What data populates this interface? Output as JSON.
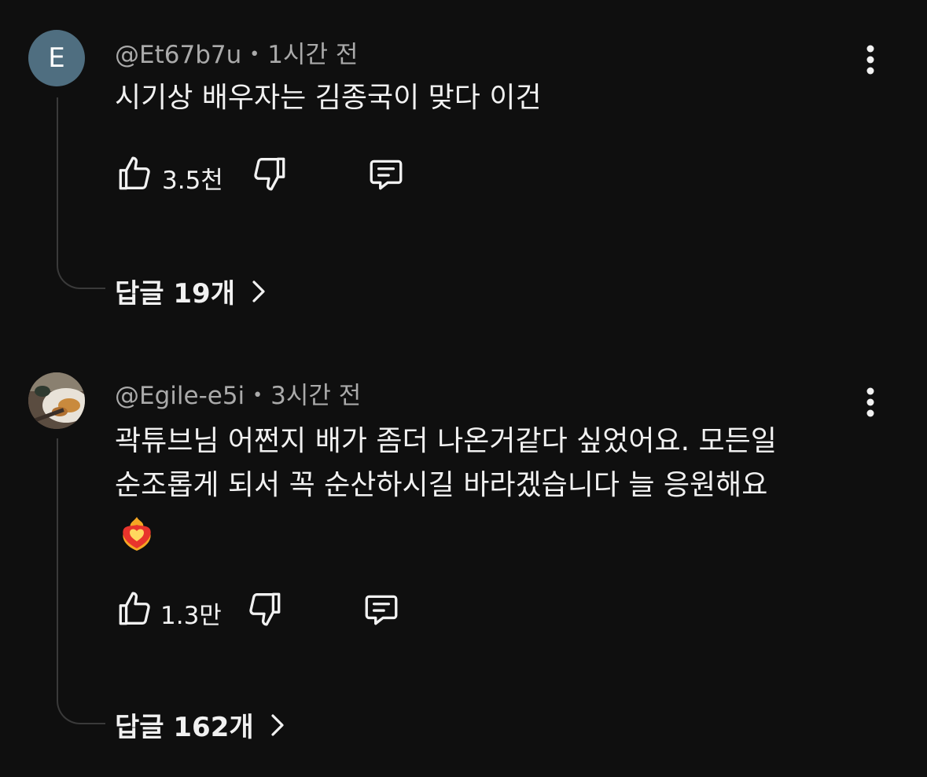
{
  "comments": [
    {
      "avatar_letter": "E",
      "author": "@Et67b7u",
      "separator": "•",
      "time": "1시간 전",
      "text": "시기상 배우자는 김종국이 맞다 이건",
      "likes": "3.5천",
      "replies_label": "답글 19개"
    },
    {
      "author": "@Egile-e5i",
      "separator": "•",
      "time": "3시간 전",
      "text_line1": "곽튜브님 어쩐지 배가 좀더 나온거같다 싶었어요. 모든일",
      "text_line2": "순조롭게 되서 꼭 순산하시길 바라겠습니다 늘 응원해요",
      "emoji": "heart-on-fire",
      "likes": "1.3만",
      "replies_label": "답글 162개"
    }
  ],
  "icons": {
    "like": "thumbs-up-icon",
    "dislike": "thumbs-down-icon",
    "reply": "reply-icon",
    "more": "more-vertical-icon",
    "chevron": "chevron-right-icon"
  },
  "colors": {
    "background": "#0f0f0f",
    "text": "#f1f1f1",
    "secondary_text": "#aaaaaa",
    "avatar_bg": "#4f6e80"
  }
}
